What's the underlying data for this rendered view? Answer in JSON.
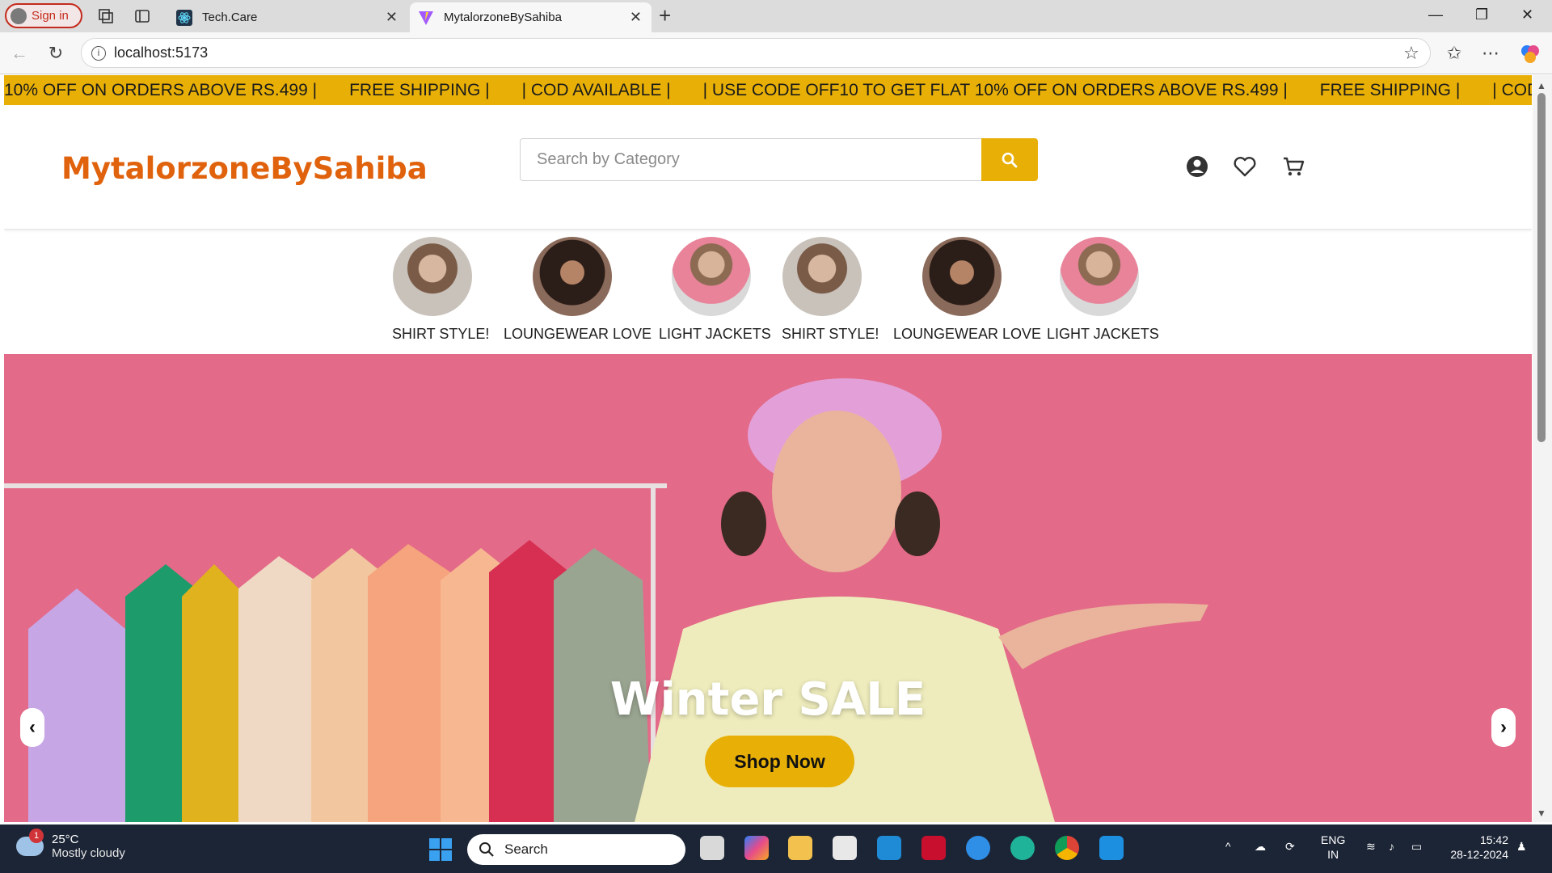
{
  "browser": {
    "signin_label": "Sign in",
    "tabs": [
      {
        "title": "Tech.Care"
      },
      {
        "title": "MytalorzoneBySahiba"
      }
    ],
    "url": "localhost:5173"
  },
  "promo": {
    "items": [
      "10% OFF ON ORDERS ABOVE RS.499 |",
      "FREE SHIPPING |",
      "| COD AVAILABLE |",
      "| USE CODE OFF10 TO GET FLAT 10% OFF ON ORDERS ABOVE RS.499 |",
      "FREE SHIPPING |",
      "| COD AVAILABLE |"
    ]
  },
  "header": {
    "logo": "MytalorzoneBySahiba",
    "search_placeholder": "Search by Category"
  },
  "categories": [
    {
      "label": "SHIRT STYLE!"
    },
    {
      "label": "LOUNGEWEAR LOVE"
    },
    {
      "label": "LIGHT JACKETS"
    },
    {
      "label": "SHIRT STYLE!"
    },
    {
      "label": "LOUNGEWEAR LOVE"
    },
    {
      "label": "LIGHT JACKETS"
    }
  ],
  "hero": {
    "title": "Winter SALE",
    "button": "Shop Now",
    "prev": "‹",
    "next": "›"
  },
  "taskbar": {
    "weather_badge": "1",
    "temperature": "25°C",
    "condition": "Mostly cloudy",
    "search_label": "Search",
    "lang_line1": "ENG",
    "lang_line2": "IN",
    "time": "15:42",
    "date": "28-12-2024"
  },
  "colors": {
    "accent": "#e8b007",
    "logo": "#e0620d",
    "hero_bg": "#e36a88"
  }
}
